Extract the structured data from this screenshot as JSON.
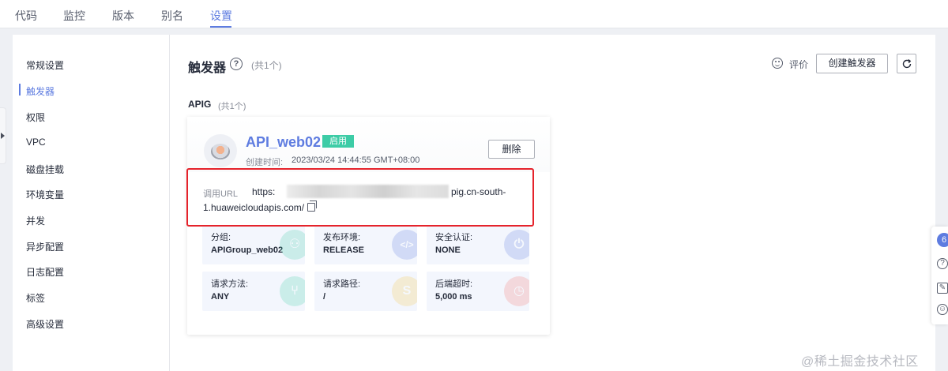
{
  "tabs": [
    {
      "label": "代码"
    },
    {
      "label": "监控"
    },
    {
      "label": "版本"
    },
    {
      "label": "别名"
    },
    {
      "label": "设置",
      "active": true
    }
  ],
  "sidebar": {
    "items": [
      {
        "label": "常规设置"
      },
      {
        "label": "触发器",
        "active": true
      },
      {
        "label": "权限"
      },
      {
        "label": "VPC"
      },
      {
        "label": "磁盘挂载"
      },
      {
        "label": "环境变量"
      },
      {
        "label": "并发"
      },
      {
        "label": "异步配置"
      },
      {
        "label": "日志配置"
      },
      {
        "label": "标签"
      },
      {
        "label": "高级设置"
      }
    ]
  },
  "header": {
    "title": "触发器",
    "help_icon": "question-circle-icon",
    "help_glyph": "?",
    "count": "(共1个)",
    "rate_label": "评价",
    "create_button": "创建触发器",
    "refresh_icon": "refresh-icon"
  },
  "group": {
    "label": "APIG",
    "count": "(共1个)"
  },
  "card": {
    "name": "API_web02",
    "status": "启用",
    "created_label": "创建时间:",
    "created_time": "2023/03/24 14:44:55 GMT+08:00",
    "delete_button": "删除",
    "url_label": "调用URL",
    "url_prefix": "https:",
    "url_suffix": "pig.cn-south-",
    "url_line2": "1.huaweicloudapis.com/",
    "copy_icon": "copy-icon",
    "info": [
      {
        "label": "分组:",
        "value": "APIGroup_web02",
        "icon": "group-icon",
        "color": "#3dcca6",
        "glyph": "⚇"
      },
      {
        "label": "发布环境:",
        "value": "RELEASE",
        "icon": "code-icon",
        "color": "#5e7ce0",
        "glyph": "</>"
      },
      {
        "label": "安全认证:",
        "value": "NONE",
        "icon": "power-icon",
        "color": "#5e7ce0",
        "glyph": "⏻"
      },
      {
        "label": "请求方法:",
        "value": "ANY",
        "icon": "branch-icon",
        "color": "#3dcca6",
        "glyph": "⑂"
      },
      {
        "label": "请求路径:",
        "value": "/",
        "icon": "path-icon",
        "color": "#f6c343",
        "glyph": "S"
      },
      {
        "label": "后端超时:",
        "value": "5,000 ms",
        "icon": "clock-icon",
        "color": "#f66f6a",
        "glyph": "◷"
      }
    ]
  },
  "floating": {
    "badge": "6",
    "icons": [
      {
        "name": "help-icon",
        "glyph": "?"
      },
      {
        "name": "edit-icon",
        "glyph": "✎"
      },
      {
        "name": "smile-icon",
        "glyph": "☺"
      }
    ]
  },
  "watermark": "@稀土掘金技术社区"
}
